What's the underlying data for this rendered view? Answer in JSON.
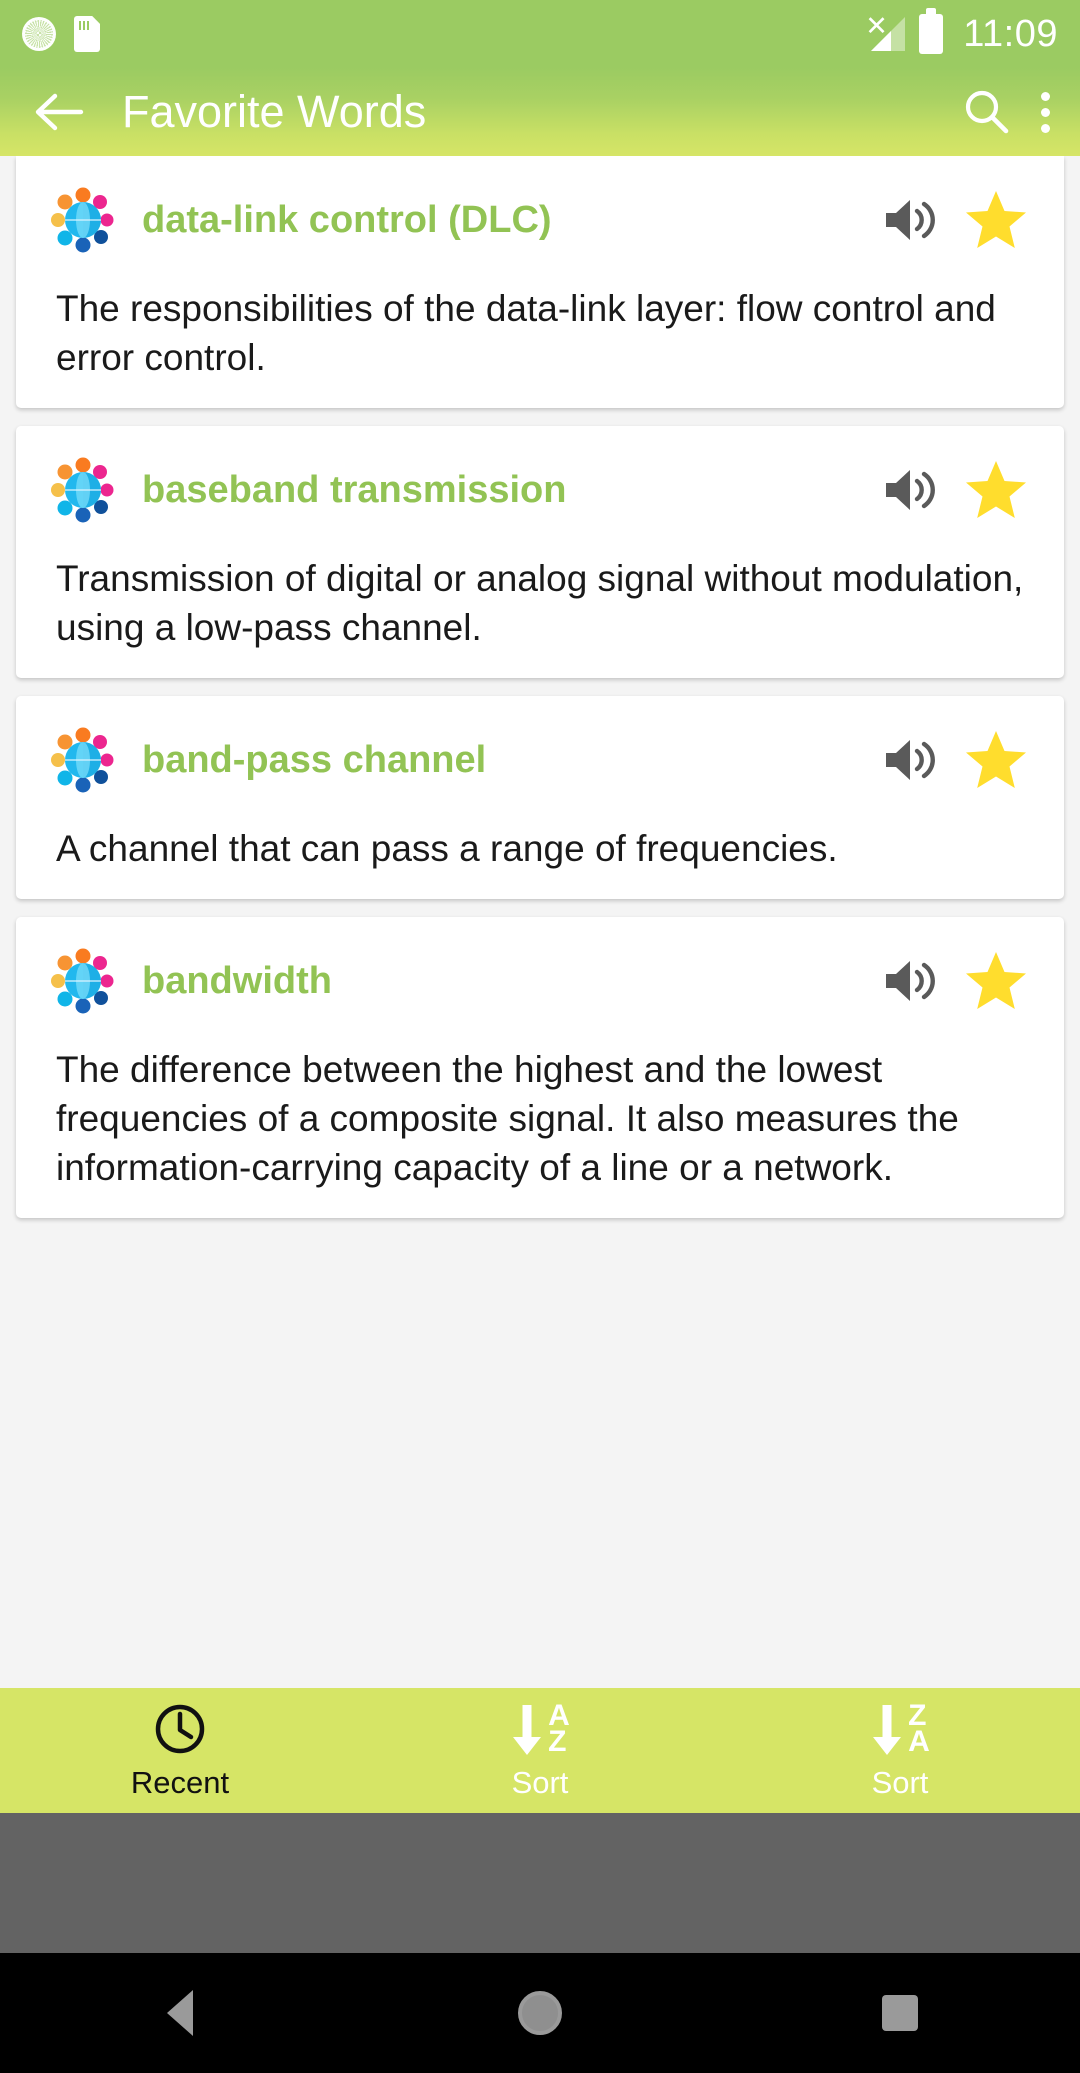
{
  "status_bar": {
    "time": "11:09",
    "icons": [
      "sync-icon",
      "sd-card-icon",
      "signal-no-service-icon",
      "battery-icon"
    ]
  },
  "app_bar": {
    "title": "Favorite Words",
    "back_icon": "back-arrow-icon",
    "search_icon": "search-icon",
    "overflow_icon": "overflow-menu-icon"
  },
  "colors": {
    "status_green": "#9bcb62",
    "appbar_gradient_start": "#9bcb62",
    "appbar_gradient_end": "#d6e566",
    "term_green": "#92c354",
    "star_yellow": "#ffdd2d",
    "speaker_gray": "#5a5a5a",
    "bottom_nav": "#d6e566",
    "card_white": "#ffffff",
    "page_bg": "#f4f4f4"
  },
  "cards": [
    {
      "term": "data-link control (DLC)",
      "definition": "The responsibilities of the data-link layer: flow control and error control.",
      "icon": "word-globe-icon",
      "speaker": "speaker-icon",
      "star": "star-filled-icon"
    },
    {
      "term": "baseband transmission",
      "definition": "Transmission of digital or analog signal without modulation, using a low-pass channel.",
      "icon": "word-globe-icon",
      "speaker": "speaker-icon",
      "star": "star-filled-icon"
    },
    {
      "term": "band-pass channel",
      "definition": "A channel that can pass a range of frequencies.",
      "icon": "word-globe-icon",
      "speaker": "speaker-icon",
      "star": "star-filled-icon"
    },
    {
      "term": "bandwidth",
      "definition": "The difference between the highest and the lowest frequencies of a composite signal. It also measures the information-carrying capacity of a line or a network.",
      "icon": "word-globe-icon",
      "speaker": "speaker-icon",
      "star": "star-filled-icon"
    }
  ],
  "bottom_nav": [
    {
      "label": "Recent",
      "icon": "clock-icon",
      "active": true
    },
    {
      "label": "Sort",
      "icon": "sort-a-z-icon",
      "letter_top": "A",
      "letter_bottom": "Z",
      "active": false
    },
    {
      "label": "Sort",
      "icon": "sort-z-a-icon",
      "letter_top": "Z",
      "letter_bottom": "A",
      "active": false
    }
  ],
  "system_nav": {
    "back": "system-back-icon",
    "home": "system-home-icon",
    "recents": "system-recents-icon"
  }
}
